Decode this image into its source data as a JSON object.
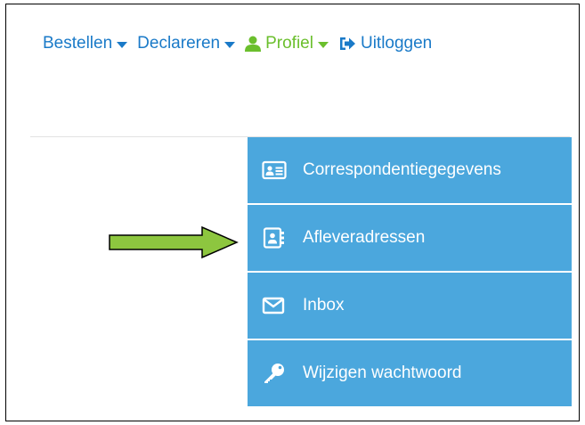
{
  "nav": {
    "bestellen": "Bestellen",
    "declareren": "Declareren",
    "profiel": "Profiel",
    "uitloggen": "Uitloggen"
  },
  "dropdown": {
    "items": [
      {
        "label": "Correspondentiegegevens",
        "icon": "id-card-icon"
      },
      {
        "label": "Afleveradressen",
        "icon": "address-book-icon"
      },
      {
        "label": "Inbox",
        "icon": "envelope-icon"
      },
      {
        "label": "Wijzigen wachtwoord",
        "icon": "key-icon"
      }
    ]
  },
  "colors": {
    "link_blue": "#1a7ac8",
    "profile_green": "#6bbf2d",
    "dropdown_bg": "#4ba7dd",
    "arrow_green": "#8dc63f"
  }
}
